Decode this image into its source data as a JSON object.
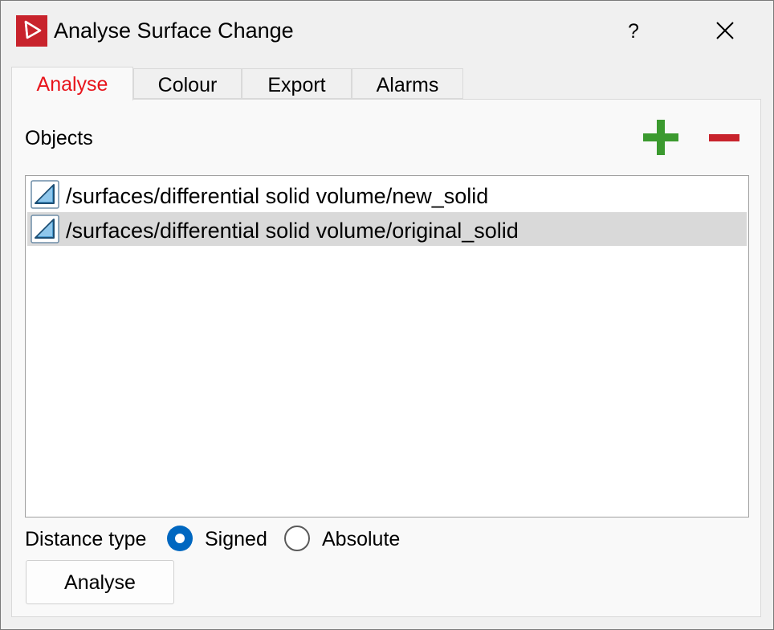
{
  "window": {
    "title": "Analyse Surface Change",
    "help_label": "?"
  },
  "tabs": [
    {
      "label": "Analyse",
      "active": true
    },
    {
      "label": "Colour",
      "active": false
    },
    {
      "label": "Export",
      "active": false
    },
    {
      "label": "Alarms",
      "active": false
    }
  ],
  "objects": {
    "label": "Objects",
    "add_icon": "plus-icon",
    "remove_icon": "minus-icon",
    "items": [
      {
        "path": "/surfaces/differential solid volume/new_solid",
        "selected": false,
        "icon": "solid-icon"
      },
      {
        "path": "/surfaces/differential solid volume/original_solid",
        "selected": true,
        "icon": "solid-icon"
      }
    ]
  },
  "distance_type": {
    "label": "Distance type",
    "options": [
      {
        "label": "Signed",
        "checked": true
      },
      {
        "label": "Absolute",
        "checked": false
      }
    ]
  },
  "actions": {
    "analyse_label": "Analyse"
  },
  "colors": {
    "active_tab": "#e8141b",
    "add": "#3b9a2f",
    "remove": "#c8232c",
    "radio_accent": "#0067c0",
    "brand": "#c8232c"
  }
}
